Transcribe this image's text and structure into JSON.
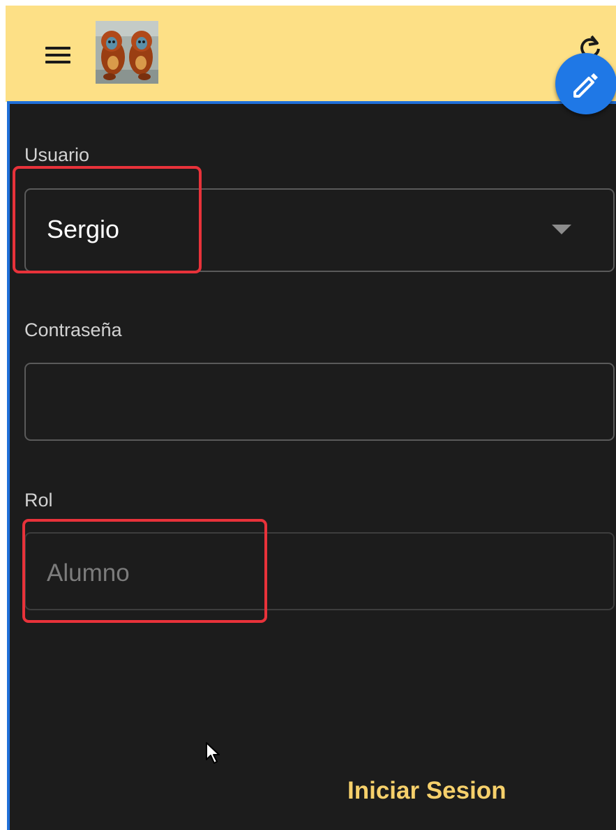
{
  "header": {
    "menu_icon": "hamburger-menu-icon",
    "logo_icon": "monkeys-logo-image",
    "refresh_icon": "refresh-icon",
    "background_color": "#fde086"
  },
  "fab": {
    "icon": "pencil-icon",
    "color": "#1f78e6"
  },
  "form": {
    "user_label": "Usuario",
    "user_value": "Sergio",
    "password_label": "Contraseña",
    "password_value": "",
    "role_label": "Rol",
    "role_value": "Alumno",
    "submit_label": "Iniciar Sesion",
    "accent_color": "#f6d06b",
    "background_color": "#1c1c1c"
  },
  "annotations": {
    "highlight_color": "#e8323a"
  }
}
